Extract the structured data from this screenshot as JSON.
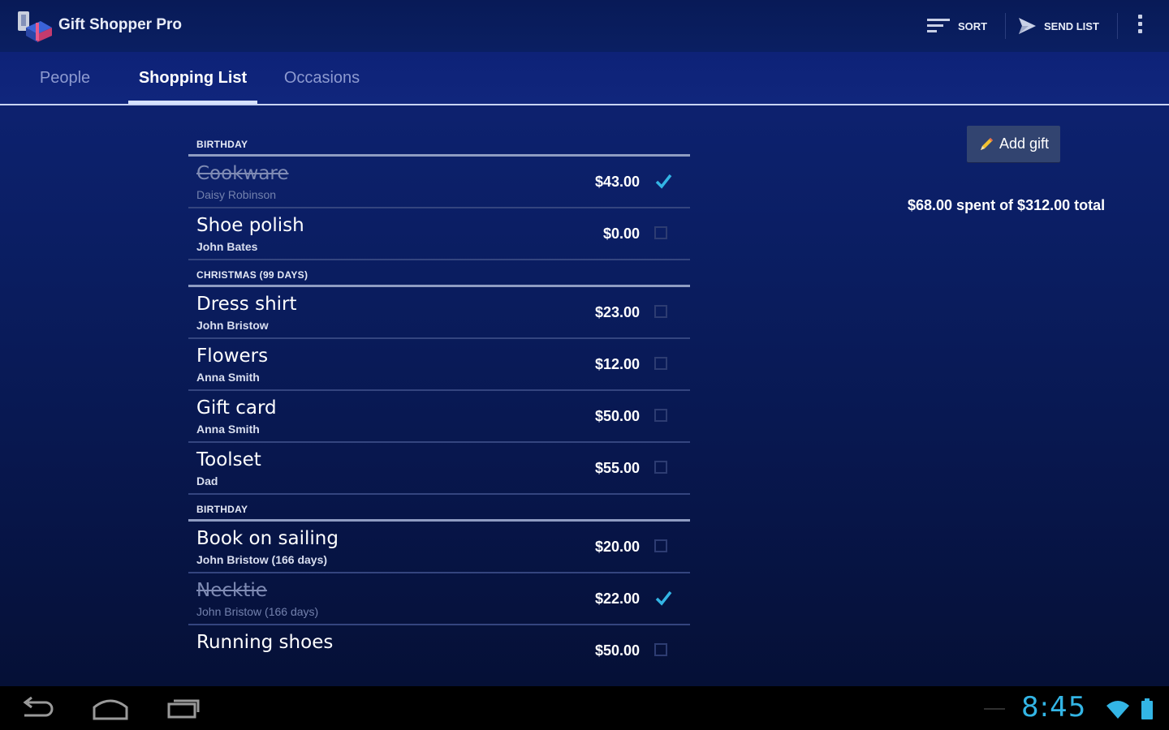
{
  "app": {
    "title": "Gift Shopper Pro",
    "actions": {
      "sort_label": "SORT",
      "send_list_label": "SEND LIST"
    }
  },
  "tabs": [
    {
      "label": "People",
      "active": false
    },
    {
      "label": "Shopping List",
      "active": true
    },
    {
      "label": "Occasions",
      "active": false
    }
  ],
  "shopping_list": {
    "sections": [
      {
        "header": "BIRTHDAY",
        "items": [
          {
            "name": "Cookware",
            "person": "Daisy Robinson",
            "price": "$43.00",
            "checked": true
          },
          {
            "name": "Shoe polish",
            "person": "John Bates",
            "price": "$0.00",
            "checked": false
          }
        ]
      },
      {
        "header": "CHRISTMAS (99 DAYS)",
        "items": [
          {
            "name": "Dress shirt",
            "person": "John Bristow",
            "price": "$23.00",
            "checked": false
          },
          {
            "name": "Flowers",
            "person": "Anna Smith",
            "price": "$12.00",
            "checked": false
          },
          {
            "name": "Gift card",
            "person": "Anna Smith",
            "price": "$50.00",
            "checked": false
          },
          {
            "name": "Toolset",
            "person": "Dad",
            "price": "$55.00",
            "checked": false
          }
        ]
      },
      {
        "header": "BIRTHDAY",
        "items": [
          {
            "name": "Book on sailing",
            "person": "John Bristow (166 days)",
            "price": "$20.00",
            "checked": false
          },
          {
            "name": "Necktie",
            "person": "John Bristow (166 days)",
            "price": "$22.00",
            "checked": true
          },
          {
            "name": "Running shoes",
            "person": "",
            "price": "$50.00",
            "checked": false
          }
        ]
      }
    ]
  },
  "side_panel": {
    "add_gift_label": "Add gift",
    "summary": "$68.00 spent of $312.00 total"
  },
  "status_bar": {
    "time": "8:45"
  },
  "colors": {
    "accent": "#33b5e5",
    "check": "#33b5e5",
    "background_top": "#0f2478",
    "background_bottom": "#051036"
  }
}
